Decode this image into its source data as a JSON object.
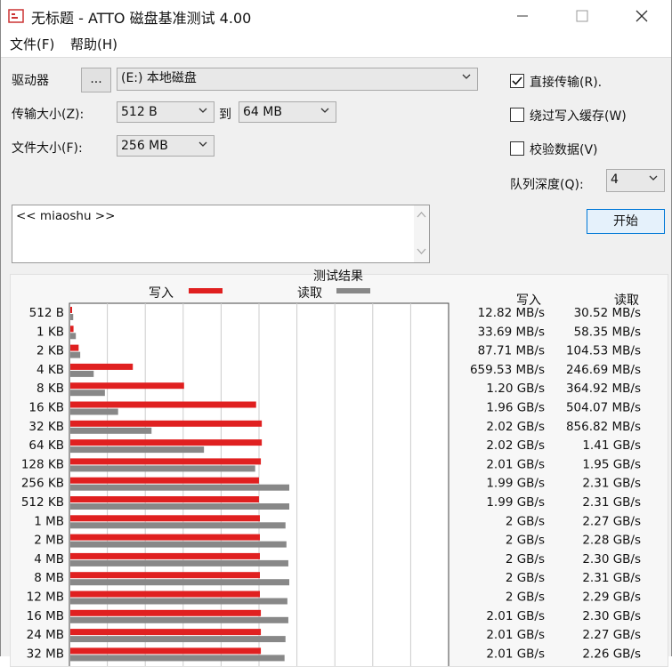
{
  "window": {
    "title": "无标题 - ATTO 磁盘基准测试 4.00"
  },
  "menu": {
    "file": "文件(F)",
    "help": "帮助(H)"
  },
  "controls": {
    "drive_label": "驱动器",
    "browse_label": "...",
    "drive_value": "(E:) 本地磁盘",
    "transfer_label": "传输大小(Z):",
    "transfer_from": "512 B",
    "to_label": "到",
    "transfer_to": "64 MB",
    "filesize_label": "文件大小(F):",
    "filesize_value": "256 MB",
    "direct_io_label": "直接传输(R).",
    "direct_io_checked": true,
    "bypass_cache_label": "绕过写入缓存(W)",
    "bypass_cache_checked": false,
    "verify_label": "校验数据(V)",
    "verify_checked": false,
    "queue_label": "队列深度(Q):",
    "queue_value": "4",
    "start_label": "开始",
    "description": "<< miaoshu >>"
  },
  "results": {
    "title": "测试结果",
    "legend_write": "写入",
    "legend_read": "读取",
    "col_write": "写入",
    "col_read": "读取",
    "write_color": "#e02020",
    "read_color": "#888888"
  },
  "chart_data": {
    "type": "bar",
    "orientation": "horizontal",
    "categories": [
      "512 B",
      "1 KB",
      "2 KB",
      "4 KB",
      "8 KB",
      "16 KB",
      "32 KB",
      "64 KB",
      "128 KB",
      "256 KB",
      "512 KB",
      "1 MB",
      "2 MB",
      "4 MB",
      "8 MB",
      "12 MB",
      "16 MB",
      "24 MB",
      "32 MB"
    ],
    "series": [
      {
        "name": "写入",
        "values": [
          0.0128,
          0.0337,
          0.0877,
          0.6595,
          1.2,
          1.96,
          2.02,
          2.02,
          2.01,
          1.99,
          1.99,
          2,
          2,
          2,
          2,
          2,
          2.01,
          2.01,
          2.01
        ]
      },
      {
        "name": "读取",
        "values": [
          0.0305,
          0.0584,
          0.1045,
          0.2467,
          0.3649,
          0.5041,
          0.8568,
          1.41,
          1.95,
          2.31,
          2.31,
          2.27,
          2.28,
          2.3,
          2.31,
          2.29,
          2.3,
          2.27,
          2.26
        ]
      }
    ],
    "xlim": [
      0,
      4
    ],
    "write_text": [
      "12.82 MB/s",
      "33.69 MB/s",
      "87.71 MB/s",
      "659.53 MB/s",
      "1.20 GB/s",
      "1.96 GB/s",
      "2.02 GB/s",
      "2.02 GB/s",
      "2.01 GB/s",
      "1.99 GB/s",
      "1.99 GB/s",
      "2 GB/s",
      "2 GB/s",
      "2 GB/s",
      "2 GB/s",
      "2 GB/s",
      "2.01 GB/s",
      "2.01 GB/s",
      "2.01 GB/s"
    ],
    "read_text": [
      "30.52 MB/s",
      "58.35 MB/s",
      "104.53 MB/s",
      "246.69 MB/s",
      "364.92 MB/s",
      "504.07 MB/s",
      "856.82 MB/s",
      "1.41 GB/s",
      "1.95 GB/s",
      "2.31 GB/s",
      "2.31 GB/s",
      "2.27 GB/s",
      "2.28 GB/s",
      "2.30 GB/s",
      "2.31 GB/s",
      "2.29 GB/s",
      "2.30 GB/s",
      "2.27 GB/s",
      "2.26 GB/s"
    ]
  }
}
